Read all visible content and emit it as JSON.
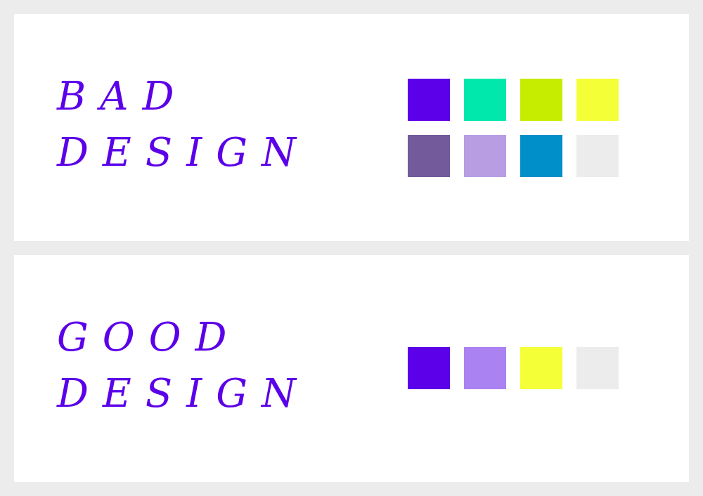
{
  "accent_color": "#5b00e8",
  "bad": {
    "title_line1": "BAD",
    "title_line2": "DESIGN",
    "swatches": [
      {
        "color": "#5b00e8"
      },
      {
        "color": "#00e8ab"
      },
      {
        "color": "#c6ec00"
      },
      {
        "color": "#f4ff38"
      },
      {
        "color": "#725a9b"
      },
      {
        "color": "#b89de3"
      },
      {
        "color": "#008fc8"
      },
      {
        "color": "#ececec"
      }
    ]
  },
  "good": {
    "title_line1": "GOOD",
    "title_line2": "DESIGN",
    "swatches": [
      {
        "color": "#5b00e8"
      },
      {
        "color": "#ab82f1"
      },
      {
        "color": "#f4ff38"
      },
      {
        "color": "#ececec"
      }
    ]
  }
}
